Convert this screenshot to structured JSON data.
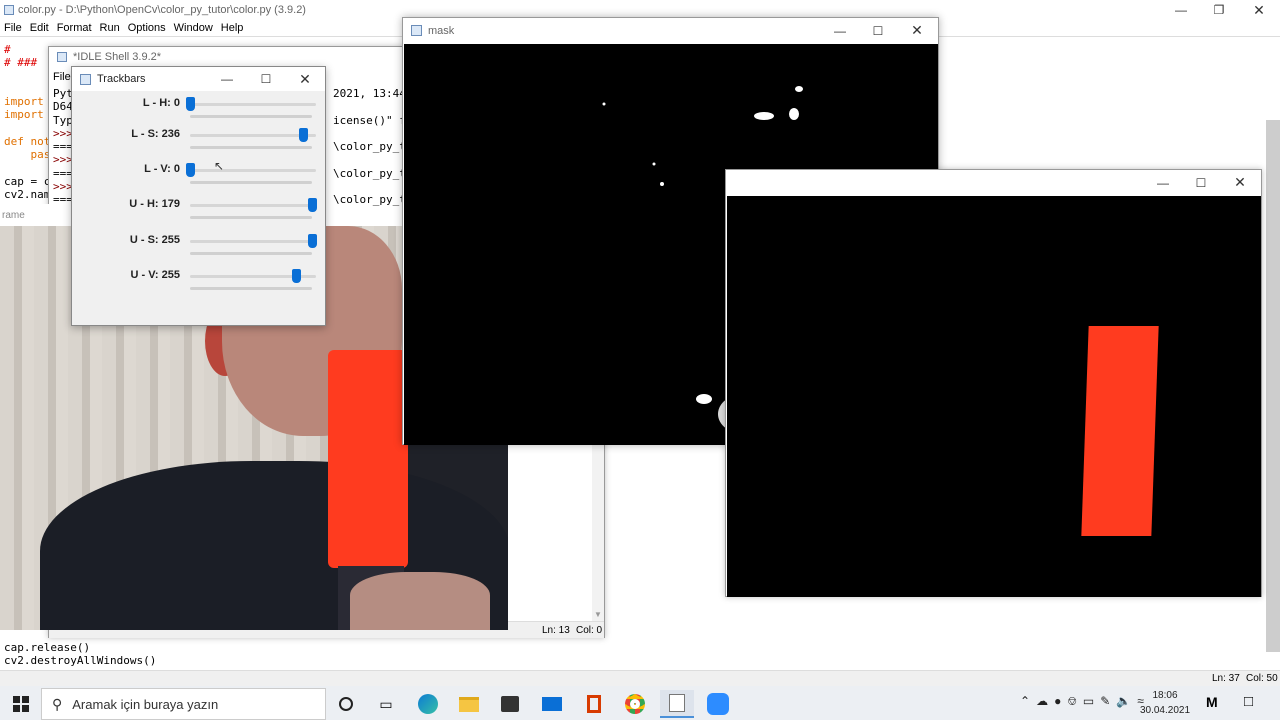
{
  "editor": {
    "title": "color.py - D:\\Python\\OpenCv\\color_py_tutor\\color.py (3.9.2)",
    "menu": [
      "File",
      "Edit",
      "Format",
      "Run",
      "Options",
      "Window",
      "Help"
    ],
    "code_top": [
      "#",
      "# ###",
      "",
      "import",
      "import",
      "",
      "def not",
      "    pas",
      "",
      "cap = c",
      "cv2.nam"
    ],
    "code_bottom": [
      "cap.release()",
      "cv2.destroyAllWindows()"
    ],
    "status": {
      "ln": "Ln: 37",
      "col": "Col: 50"
    }
  },
  "shell": {
    "title": "*IDLE Shell 3.9.2*",
    "menu_first": "File",
    "lines_left": [
      "Pyt",
      "D64",
      "Typ",
      ">>>",
      "===",
      ">>>",
      "===",
      ">>>",
      "==="
    ],
    "lines_right": [
      "2021, 13:44",
      "",
      "icense()\" fo",
      "",
      "\\color_py_tu",
      "",
      "\\color_py_tu",
      "",
      "\\color_py_tu"
    ],
    "status": {
      "ln": "Ln: 13",
      "col": "Col: 0"
    }
  },
  "frame_window": {
    "title": "rame"
  },
  "trackbars": {
    "title": "Trackbars",
    "items": [
      {
        "label": "L - H: 0",
        "fraction": 0.0
      },
      {
        "label": "L - S: 236",
        "fraction": 0.925
      },
      {
        "label": "L - V: 0",
        "fraction": 0.0
      },
      {
        "label": "U - H: 179",
        "fraction": 1.0
      },
      {
        "label": "U - S: 255",
        "fraction": 1.0
      },
      {
        "label": "U - V: 255",
        "fraction": 0.87
      }
    ]
  },
  "mask_window": {
    "title": "mask"
  },
  "taskbar": {
    "search_placeholder": "Aramak için buraya yazın",
    "time": "18:06",
    "date": "30.04.2021"
  },
  "colors": {
    "accent": "#0a6fd6",
    "orange": "#ff3b1f"
  }
}
